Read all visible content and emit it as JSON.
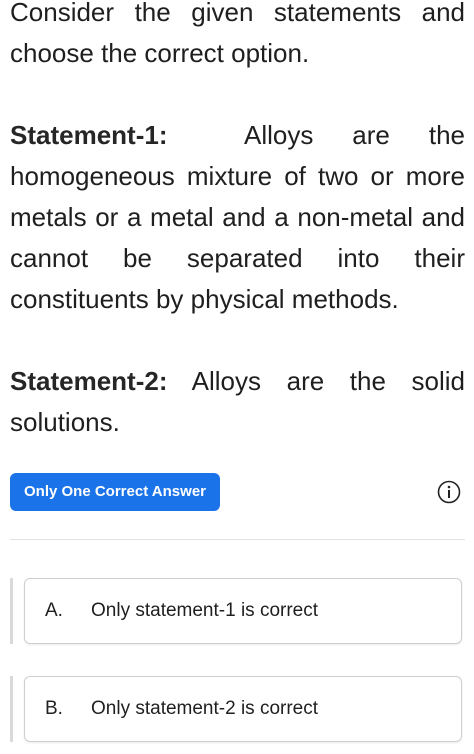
{
  "question": {
    "intro": "Consider the given statements and choose the correct option.",
    "statement1": {
      "label": "Statement-1:",
      "text": "Alloys are the homogeneous mixture of two or more metals or a metal and a non-metal and cannot be separated into their constituents by physical methods."
    },
    "statement2": {
      "label": "Statement-2:",
      "text": "Alloys are the solid solutions."
    }
  },
  "answer_type": {
    "badge_label": "Only One Correct Answer",
    "info_icon": "info-circle-icon"
  },
  "options": [
    {
      "letter": "A.",
      "text": "Only statement-1 is correct"
    },
    {
      "letter": "B.",
      "text": "Only statement-2 is correct"
    }
  ],
  "colors": {
    "badge_bg": "#1a73e8",
    "badge_text": "#ffffff",
    "text": "#1f1f1f",
    "option_border": "#cfcfcf",
    "option_bar": "#d9d9d9"
  }
}
